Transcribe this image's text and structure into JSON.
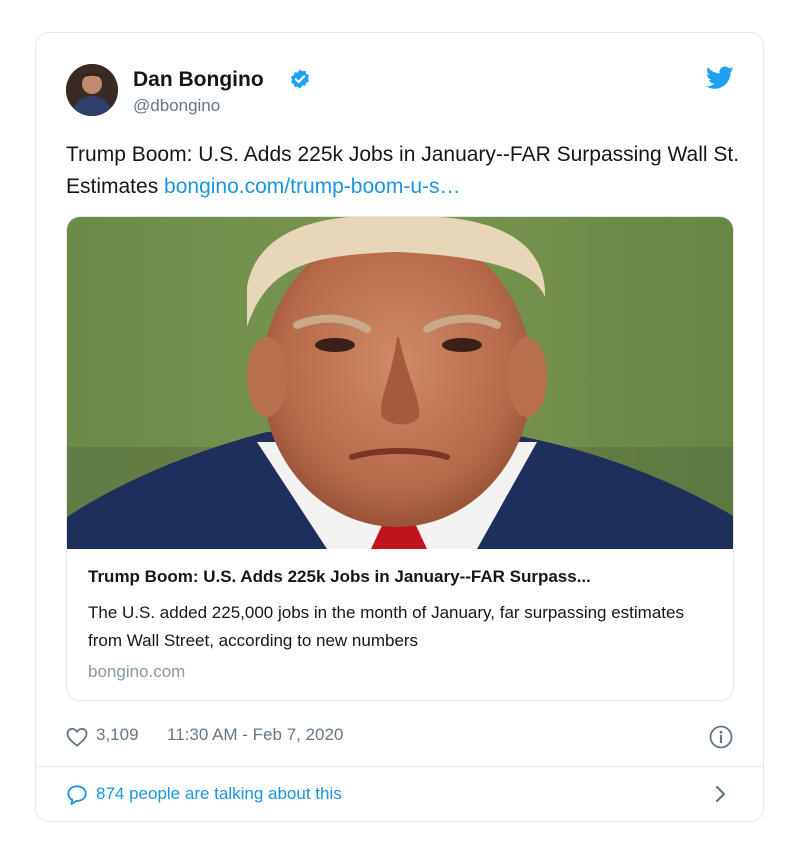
{
  "tweet": {
    "author": {
      "name": "Dan Bongino",
      "handle": "@dbongino",
      "verified": true,
      "avatar_icon": "profile-photo"
    },
    "text": "Trump Boom: U.S. Adds 225k Jobs in January--FAR Surpassing Wall St. Estimates",
    "link_text": "bongino.com/trump-boom-u-s…",
    "link_card": {
      "image_description_icon": "news-photo",
      "title": "Trump Boom: U.S. Adds 225k Jobs in January--FAR Surpass...",
      "description": "The U.S. added 225,000 jobs in the month of January, far surpassing estimates from Wall Street, according to new numbers",
      "domain": "bongino.com"
    },
    "likes": "3,109",
    "timestamp": "11:30 AM - Feb 7, 2020",
    "conversation": "874 people are talking about this"
  },
  "colors": {
    "brand_blue": "#1da1f2",
    "link_blue": "#1b95e0",
    "text": "#14171a",
    "muted": "#657786",
    "border": "#e1e8ed"
  },
  "icons": [
    "verified-badge-icon",
    "twitter-bird-icon",
    "heart-icon",
    "info-icon",
    "chat-bubble-icon",
    "chevron-right-icon"
  ]
}
